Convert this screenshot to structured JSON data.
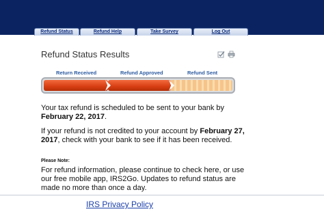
{
  "nav": {
    "tabs": [
      {
        "label": "Refund Status"
      },
      {
        "label": "Refund Help"
      },
      {
        "label": "Take Survey"
      },
      {
        "label": "Log Out"
      }
    ]
  },
  "page": {
    "title": "Refund Status Results",
    "icons": [
      "checkmark-icon",
      "print-icon"
    ]
  },
  "progress": {
    "steps": [
      {
        "label": "Return Received",
        "status": "complete"
      },
      {
        "label": "Refund Approved",
        "status": "complete"
      },
      {
        "label": "Refund Sent",
        "status": "pending"
      }
    ],
    "completed_fraction": 0.667,
    "colors": {
      "complete": "#d83e12",
      "pending": "#f6c48a",
      "label": "#2c5aa0"
    }
  },
  "message": {
    "p1_text": "Your tax refund is scheduled to be sent to your bank by",
    "p1_date": "February 22, 2017",
    "p1_end": ".",
    "p2_start": "If your refund is not credited to your account by",
    "p2_date": "February 27, 2017",
    "p2_end": ", check with your bank to see if it has been received.",
    "note_title": "Please Note:",
    "note_text": "For refund information, please continue to check here, or use our free mobile app, IRS2Go. Updates to refund status are made no more than once a day."
  },
  "footer": {
    "privacy_link": "IRS Privacy Policy"
  },
  "colors": {
    "header_bg": "#0b2461",
    "link": "#1a3ea8"
  }
}
